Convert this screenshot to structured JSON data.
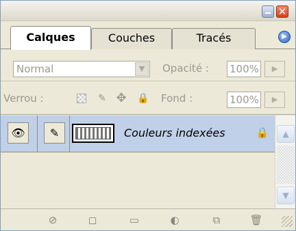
{
  "window": {
    "min_icon": "minimize-icon",
    "close_glyph": "✕"
  },
  "tabs": [
    {
      "label": "Calques"
    },
    {
      "label": "Couches"
    },
    {
      "label": "Tracés"
    }
  ],
  "tab_menu": {
    "glyph": "▶"
  },
  "blend": {
    "mode": "Normal",
    "arrow": "▼",
    "opacity_label": "Opacité :",
    "opacity_value": "100%",
    "stepper": "▶"
  },
  "lock": {
    "label": "Verrou :",
    "brush_glyph": "✎",
    "move_glyph": "✥",
    "padlock_glyph": "🔒",
    "fill_label": "Fond :",
    "fill_value": "100%",
    "stepper": "▶"
  },
  "layer": {
    "eye_glyph": "👁",
    "brush_glyph": "✎",
    "name": "Couleurs indexées",
    "lock_glyph": "🔒"
  },
  "scroll": {
    "up": "▲",
    "down": "▼"
  },
  "bottom": {
    "link": "⊘",
    "mask": "◻",
    "folder": "▭",
    "adjust": "◐",
    "new": "⧉",
    "trash": "🗑"
  }
}
